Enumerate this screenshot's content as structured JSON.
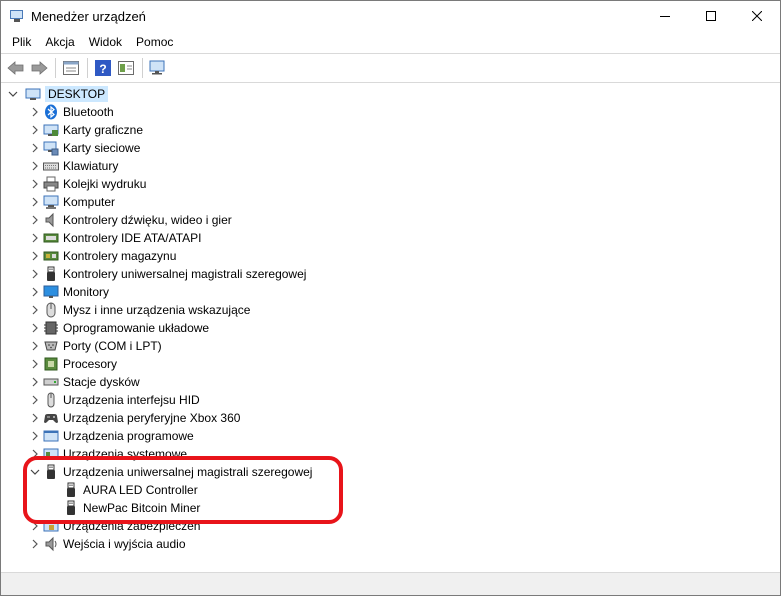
{
  "window": {
    "title": "Menedżer urządzeń"
  },
  "menu": [
    "Plik",
    "Akcja",
    "Widok",
    "Pomoc"
  ],
  "tree": {
    "root": {
      "label": "DESKTOP",
      "icon": "computer-icon"
    },
    "categories": [
      {
        "label": "Bluetooth",
        "icon": "bluetooth-icon",
        "expanded": false
      },
      {
        "label": "Karty graficzne",
        "icon": "display-adapter-icon",
        "expanded": false
      },
      {
        "label": "Karty sieciowe",
        "icon": "network-adapter-icon",
        "expanded": false
      },
      {
        "label": "Klawiatury",
        "icon": "keyboard-icon",
        "expanded": false
      },
      {
        "label": "Kolejki wydruku",
        "icon": "printer-icon",
        "expanded": false
      },
      {
        "label": "Komputer",
        "icon": "computer-icon",
        "expanded": false
      },
      {
        "label": "Kontrolery dźwięku, wideo i gier",
        "icon": "speaker-icon",
        "expanded": false
      },
      {
        "label": "Kontrolery IDE ATA/ATAPI",
        "icon": "ide-controller-icon",
        "expanded": false
      },
      {
        "label": "Kontrolery magazynu",
        "icon": "storage-controller-icon",
        "expanded": false
      },
      {
        "label": "Kontrolery uniwersalnej magistrali szeregowej",
        "icon": "usb-icon",
        "expanded": false
      },
      {
        "label": "Monitory",
        "icon": "monitor-icon",
        "expanded": false
      },
      {
        "label": "Mysz i inne urządzenia wskazujące",
        "icon": "mouse-icon",
        "expanded": false
      },
      {
        "label": "Oprogramowanie układowe",
        "icon": "firmware-icon",
        "expanded": false
      },
      {
        "label": "Porty (COM i LPT)",
        "icon": "port-icon",
        "expanded": false
      },
      {
        "label": "Procesory",
        "icon": "processor-icon",
        "expanded": false
      },
      {
        "label": "Stacje dysków",
        "icon": "disk-drive-icon",
        "expanded": false
      },
      {
        "label": "Urządzenia interfejsu HID",
        "icon": "hid-icon",
        "expanded": false
      },
      {
        "label": "Urządzenia peryferyjne Xbox 360",
        "icon": "gamepad-icon",
        "expanded": false
      },
      {
        "label": "Urządzenia programowe",
        "icon": "software-device-icon",
        "expanded": false
      },
      {
        "label": "Urządzenia systemowe",
        "icon": "system-device-icon",
        "expanded": false
      },
      {
        "label": "Urządzenia uniwersalnej magistrali szeregowej",
        "icon": "usb-icon",
        "expanded": true,
        "children": [
          {
            "label": "AURA LED Controller",
            "icon": "usb-icon"
          },
          {
            "label": "NewPac Bitcoin Miner",
            "icon": "usb-icon"
          }
        ]
      },
      {
        "label": "Urządzenia zabezpieczeń",
        "icon": "security-device-icon",
        "expanded": false
      },
      {
        "label": "Wejścia i wyjścia audio",
        "icon": "audio-io-icon",
        "expanded": false
      }
    ]
  },
  "colors": {
    "highlight": "#e8141a",
    "selection": "#cce8ff"
  }
}
